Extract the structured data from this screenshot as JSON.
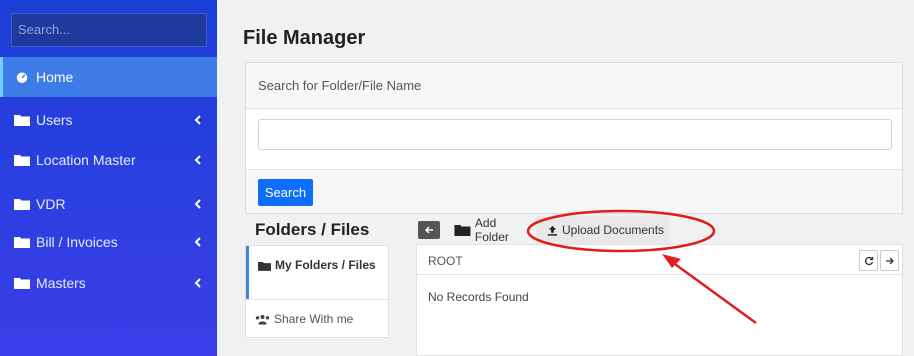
{
  "sidebar": {
    "search_placeholder": "Search...",
    "items": [
      {
        "label": "Home",
        "icon": "dashboard-icon",
        "active": true
      },
      {
        "label": "Users",
        "icon": "folder-icon"
      },
      {
        "label": "Location Master",
        "icon": "folder-icon"
      },
      {
        "label": "VDR",
        "icon": "folder-icon"
      },
      {
        "label": "Bill / Invoices",
        "icon": "folder-icon"
      },
      {
        "label": "Masters",
        "icon": "folder-icon"
      }
    ]
  },
  "main": {
    "title": "File Manager",
    "search_panel": {
      "header": "Search for Folder/File Name",
      "input_value": "",
      "button_label": "Search"
    },
    "folders_files": {
      "title": "Folders / Files",
      "items": [
        {
          "label": "My Folders / Files",
          "icon": "folder-icon",
          "active": true
        },
        {
          "label": "Share With me",
          "icon": "users-icon"
        }
      ]
    },
    "toolbar": {
      "back_icon": "arrow-left-icon",
      "add_folder_label": "Add Folder",
      "upload_label": "Upload Documents"
    },
    "file_area": {
      "path": "ROOT",
      "empty_text": "No Records Found",
      "refresh_icon": "refresh-icon",
      "forward_icon": "arrow-right-icon"
    }
  },
  "colors": {
    "sidebar_top": "#1a3fd6",
    "sidebar_bottom": "#3b3ee8",
    "active_item": "#3d7be6",
    "primary_button": "#0d6efd",
    "annotation": "#e11d1d"
  }
}
